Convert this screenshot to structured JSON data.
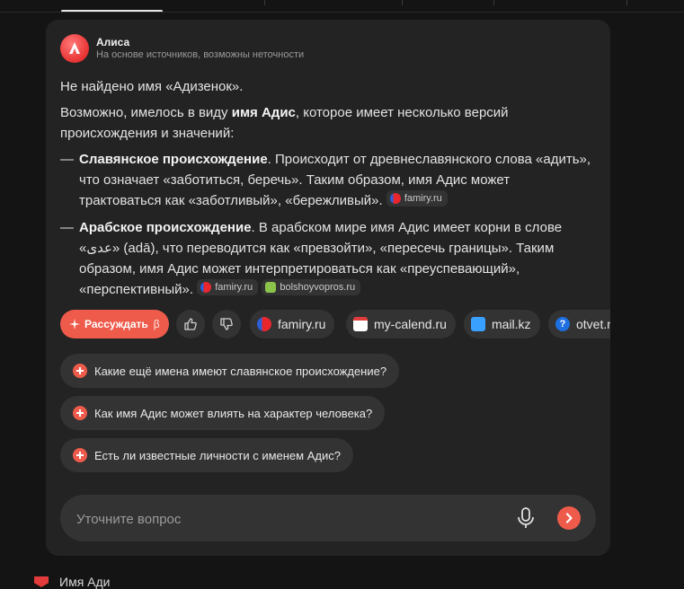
{
  "assistant": {
    "name": "Алиса",
    "subtitle": "На основе источников, возможны неточности"
  },
  "answer": {
    "not_found": "Не найдено имя «Адизенок».",
    "intro_pre": "Возможно, имелось в виду ",
    "intro_bold": "имя Адис",
    "intro_post": ", которое имеет несколько версий происхождения и значений:",
    "items": [
      {
        "dash": "—",
        "title": "Славянское происхождение",
        "text": ". Происходит от древнеславянского слова «адить», что означает «заботиться, беречь». Таким образом, имя Адис может трактоваться как «заботливый», «бережливый».",
        "sources": [
          "famiry.ru"
        ]
      },
      {
        "dash": "—",
        "title": "Арабское происхождение",
        "text": ". В арабском мире имя Адис имеет корни в слове «عدى» (adā), что переводится как «превзойти», «пересечь границы». Таким образом, имя Адис может интерпретироваться как «преуспевающий», «перспективный».",
        "sources": [
          "famiry.ru",
          "bolshoyvopros.ru"
        ]
      }
    ]
  },
  "actions": {
    "think_label": "Рассуждать",
    "think_badge": "β",
    "like_icon": "thumbs-up-icon",
    "dislike_icon": "thumbs-down-icon",
    "sources": [
      "famiry.ru",
      "my-calend.ru",
      "mail.kz",
      "otvet.mail.ru"
    ]
  },
  "suggestions": [
    "Какие ещё имена имеют славянское происхождение?",
    "Как имя Адис может влиять на характер человека?",
    "Есть ли известные личности с именем Адис?"
  ],
  "input": {
    "placeholder": "Уточните вопрос",
    "value": ""
  },
  "footer": {
    "text": "Имя Ади"
  },
  "colors": {
    "accent": "#ee5b4b",
    "card": "#232323",
    "background": "#141414"
  }
}
